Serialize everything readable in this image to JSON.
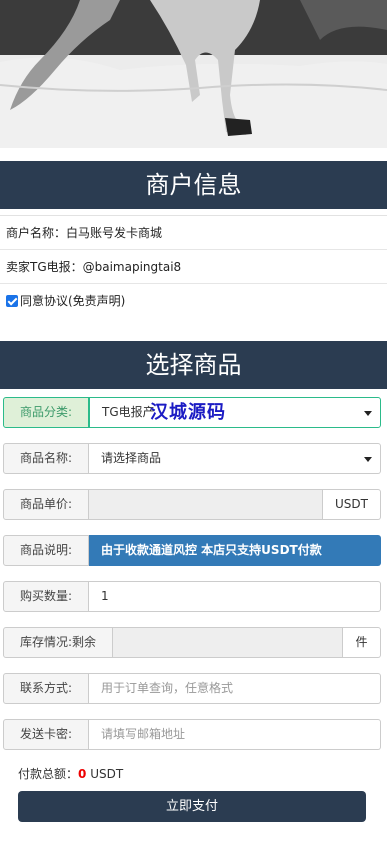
{
  "merchant_section": {
    "title": "商户信息",
    "name_line": "商户名称：白马账号发卡商城",
    "tg_line": "卖家TG电报：@baimapingtai8",
    "agree_label": "同意协议(免责声明)"
  },
  "product_section": {
    "title": "选择商品",
    "category": {
      "label": "商品分类:",
      "value": "TG电报产",
      "overlay": "汉城源码"
    },
    "name": {
      "label": "商品名称:",
      "value": "请选择商品"
    },
    "price": {
      "label": "商品单价:",
      "value": "",
      "unit": "USDT"
    },
    "desc": {
      "label": "商品说明:",
      "value": "由于收款通道风控 本店只支持USDT付款"
    },
    "qty": {
      "label": "购买数量:",
      "value": "1"
    },
    "stock": {
      "label": "库存情况:",
      "sub": "剩余",
      "value": "",
      "unit": "件"
    },
    "contact": {
      "label": "联系方式:",
      "placeholder": "用于订单查询，任意格式"
    },
    "email": {
      "label": "发送卡密:",
      "placeholder": "请填写邮箱地址"
    },
    "total": {
      "label": "付款总额：",
      "amount": "0",
      "currency": "USDT"
    },
    "pay_button": "立即支付"
  }
}
